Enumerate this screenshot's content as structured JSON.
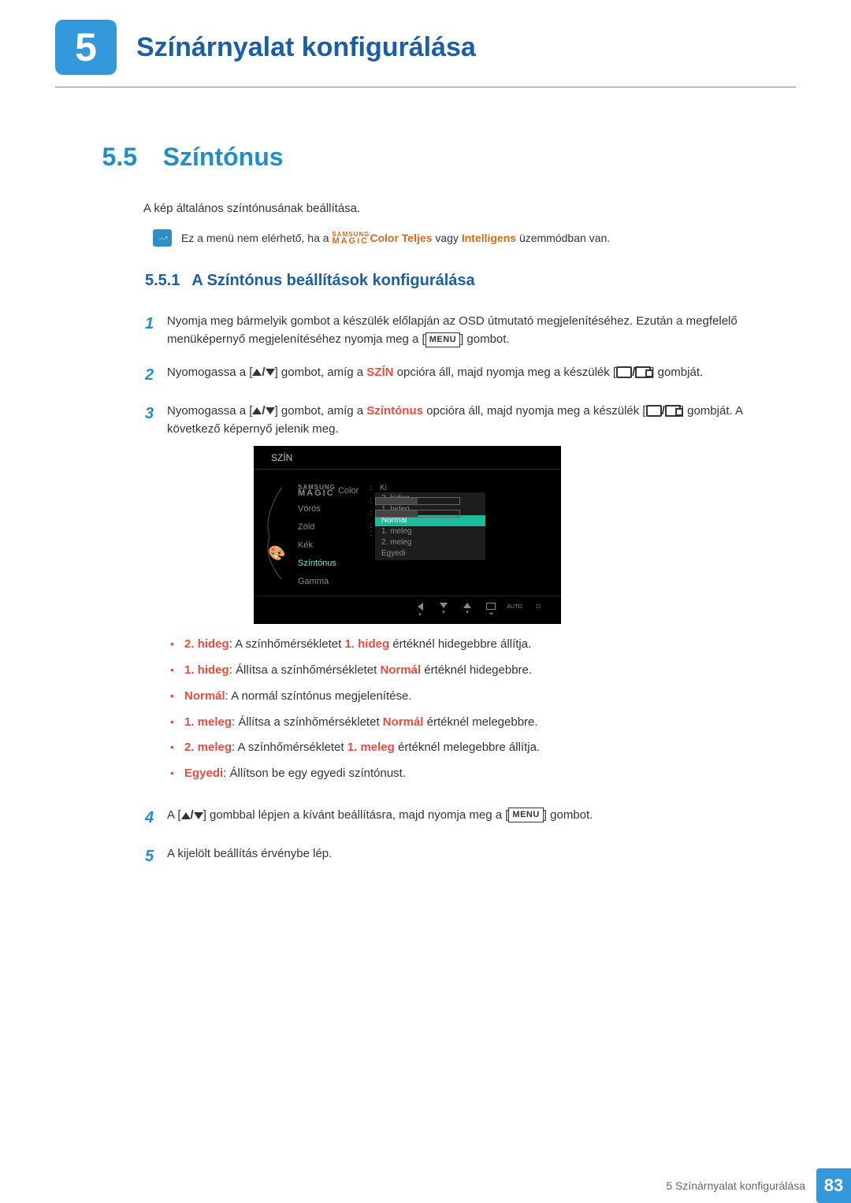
{
  "chapter": {
    "number": "5",
    "title": "Színárnyalat konfigurálása"
  },
  "section": {
    "number": "5.5",
    "title": "Színtónus",
    "intro": "A kép általános színtónusának beállítása."
  },
  "note": {
    "pre": "Ez a menü nem elérhető, ha a ",
    "brand_top": "SAMSUNG",
    "brand_bot": "MAGIC",
    "brand_after": "Color",
    "mode1": "Teljes",
    "mid": " vagy ",
    "mode2": "Intelligens",
    "post": " üzemmódban van."
  },
  "subsection": {
    "number": "5.5.1",
    "title": "A Színtónus beállítások konfigurálása"
  },
  "steps": {
    "s1": {
      "n": "1",
      "a": "Nyomja meg bármelyik gombot a készülék előlapján az OSD útmutató megjelenítéséhez. Ezután a megfelelő menüképernyő megjelenítéséhez nyomja meg a [",
      "b": "] gombot."
    },
    "s2": {
      "n": "2",
      "a": "Nyomogassa a [",
      "b": "] gombot, amíg a ",
      "key": "SZÍN",
      "c": " opcióra áll, majd nyomja meg a készülék [",
      "d": "] gombját."
    },
    "s3": {
      "n": "3",
      "a": "Nyomogassa a [",
      "b": "] gombot, amíg a ",
      "key": "Színtónus",
      "c": " opcióra áll, majd nyomja meg a készülék [",
      "d": "] gombját. A következő képernyő jelenik meg."
    },
    "s4": {
      "n": "4",
      "a": "A [",
      "b": "] gombbal lépjen a kívánt beállításra, majd nyomja meg a [",
      "c": "] gombot."
    },
    "s5": {
      "n": "5",
      "text": "A kijelölt beállítás érvénybe lép."
    }
  },
  "osd": {
    "title": "SZÍN",
    "items": [
      "Color",
      "Vörös",
      "Zöld",
      "Kék",
      "Színtónus",
      "Gamma"
    ],
    "magic_top": "SAMSUNG",
    "magic_bot": "MAGIC",
    "ki": "Ki",
    "val50a": "50",
    "val50b": "50",
    "options": [
      "2. hideg",
      "1. hideg",
      "Normál",
      "1. meleg",
      "2. meleg",
      "Egyedi"
    ],
    "nav_auto": "AUTO"
  },
  "bullets": {
    "b1": {
      "k": "2. hideg",
      "t1": ": A színhőmérsékletet ",
      "k2": "1. hideg",
      "t2": " értéknél hidegebbre állítja."
    },
    "b2": {
      "k": "1. hideg",
      "t1": ": Állítsa a színhőmérsékletet ",
      "k2": "Normál",
      "t2": " értéknél hidegebbre."
    },
    "b3": {
      "k": "Normál",
      "t": ": A normál színtónus megjelenítése."
    },
    "b4": {
      "k": "1. meleg",
      "t1": ": Állítsa a színhőmérsékletet ",
      "k2": "Normál",
      "t2": " értéknél melegebbre."
    },
    "b5": {
      "k": "2. meleg",
      "t1": ": A színhőmérsékletet ",
      "k2": "1. meleg",
      "t2": " értéknél melegebbre állítja."
    },
    "b6": {
      "k": "Egyedi",
      "t": ": Állítson be egy egyedi színtónust."
    }
  },
  "menu_label": "MENU",
  "footer": {
    "label": "5 Színárnyalat konfigurálása",
    "page": "83"
  }
}
